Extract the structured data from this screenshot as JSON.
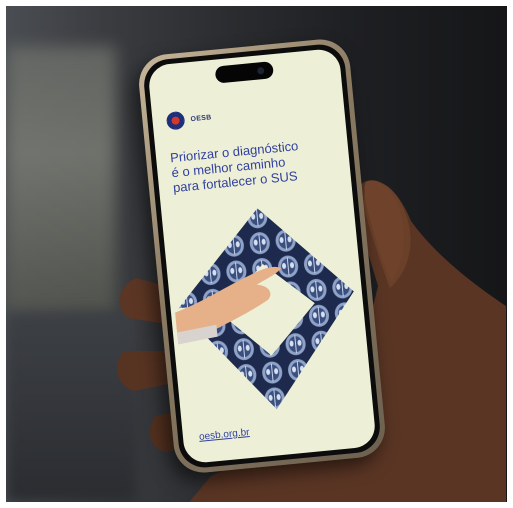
{
  "brand": {
    "name": "OESB",
    "logo_icon": "oesb-logo-icon"
  },
  "headline": {
    "line1": "Priorizar o diagnóstico",
    "line2": "é o melhor caminho",
    "line3": "para fortalecer o SUS"
  },
  "footer": {
    "url": "oesb.org.br"
  },
  "colors": {
    "screen_background": "#edf0d6",
    "text_blue": "#3140a0",
    "scan_blue": "#2a3a66"
  }
}
